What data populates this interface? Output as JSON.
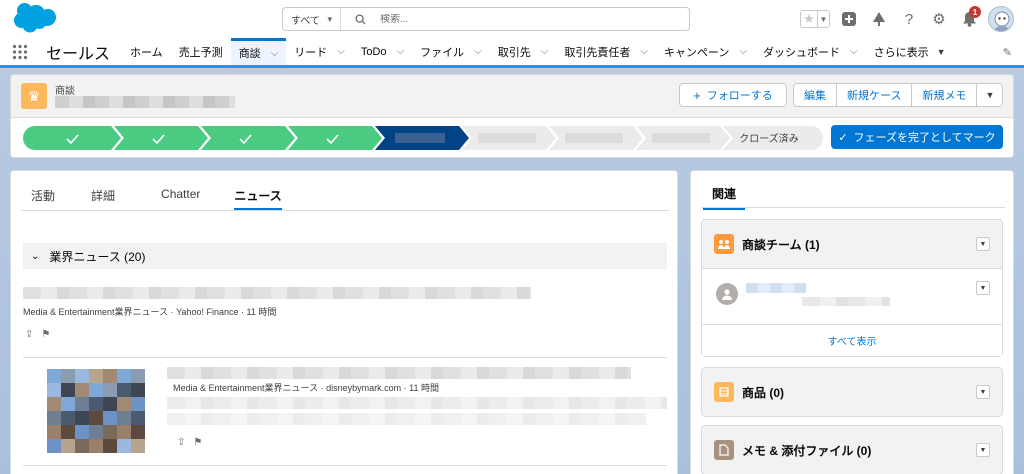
{
  "global_header": {
    "search_scope": "すべて",
    "search_placeholder": "検索...",
    "notification_count": "1"
  },
  "nav": {
    "app_name": "セールス",
    "items": [
      {
        "label": "ホーム",
        "has_menu": false
      },
      {
        "label": "売上予測",
        "has_menu": false
      },
      {
        "label": "商談",
        "has_menu": true
      },
      {
        "label": "リード",
        "has_menu": true
      },
      {
        "label": "ToDo",
        "has_menu": true
      },
      {
        "label": "ファイル",
        "has_menu": true
      },
      {
        "label": "取引先",
        "has_menu": true
      },
      {
        "label": "取引先責任者",
        "has_menu": true
      },
      {
        "label": "キャンペーン",
        "has_menu": true
      },
      {
        "label": "ダッシュボード",
        "has_menu": true
      }
    ],
    "more_label": "さらに表示",
    "active_index": 2
  },
  "record": {
    "object_label": "商談",
    "follow_label": "フォローする",
    "actions": [
      "編集",
      "新規ケース",
      "新規メモ"
    ]
  },
  "path": {
    "final_stage": "クローズ済み",
    "cta_label": "フェーズを完了としてマーク",
    "completed_stage_count": 4,
    "current_stage_index": 4
  },
  "main": {
    "tabs": [
      "活動",
      "詳細",
      "Chatter",
      "ニュース"
    ],
    "active_tab": "ニュース",
    "news_section_label": "業界ニュース (20)",
    "news_items": [
      {
        "source": "Media & Entertainment業界ニュース · Yahoo! Finance · 11 時間"
      },
      {
        "source": "Media & Entertainment業界ニュース · disneybymark.com · 11 時間"
      }
    ]
  },
  "related": {
    "tab_label": "関連",
    "sections": [
      {
        "title": "商談チーム (1)",
        "icon": "team-icon",
        "color": "#ff9a3c",
        "footer": "すべて表示"
      },
      {
        "title": "商品 (0)",
        "icon": "product-icon",
        "color": "#fcb95b"
      },
      {
        "title": "メモ & 添付ファイル (0)",
        "icon": "note-icon",
        "color": "#a8927d"
      }
    ]
  },
  "colors": {
    "brand": "#0176d3",
    "path_complete": "#4bca81",
    "path_current": "#014486"
  }
}
